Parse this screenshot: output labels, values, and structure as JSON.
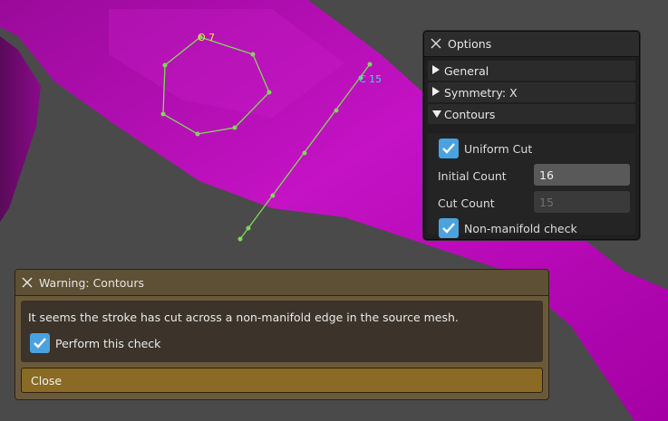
{
  "viewport": {
    "labels": {
      "cyclic_count": "O 7",
      "cut_count": "C 15"
    }
  },
  "options_panel": {
    "title": "Options",
    "sections": [
      {
        "label": "General",
        "expanded": false
      },
      {
        "label": "Symmetry: X",
        "expanded": false
      },
      {
        "label": "Contours",
        "expanded": true
      }
    ],
    "contours": {
      "uniform_cut": {
        "label": "Uniform Cut",
        "checked": true
      },
      "initial_count": {
        "label": "Initial Count",
        "value": "16"
      },
      "cut_count": {
        "label": "Cut Count",
        "value": "15",
        "disabled": true
      },
      "non_manifold_check": {
        "label": "Non-manifold check",
        "checked": true
      }
    }
  },
  "warning_dialog": {
    "title": "Warning: Contours",
    "message": "It seems the stroke has cut across a non-manifold edge in the source mesh.",
    "perform_check": {
      "label": "Perform this check",
      "checked": true
    },
    "close_label": "Close"
  },
  "colors": {
    "mesh_magenta": "#b000b0",
    "stroke_green": "#7ed957",
    "label_yellow": "#f5e642",
    "label_cyan": "#3fd6e6",
    "checkbox_blue": "#4aa3df"
  }
}
